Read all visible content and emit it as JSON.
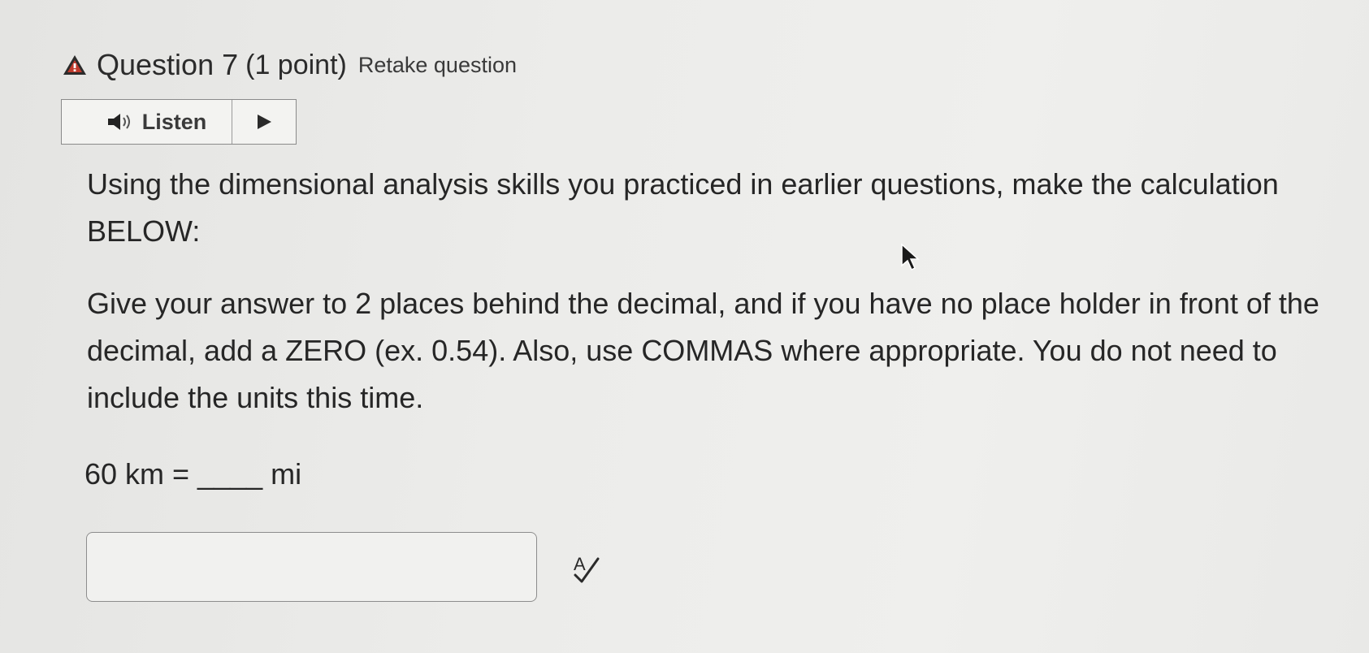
{
  "question": {
    "title": "Question 7",
    "points": "(1 point)",
    "retake_label": "Retake question",
    "status_icon": "warning-triangle-icon",
    "accent_color": "#c0392b"
  },
  "listen": {
    "label": "Listen",
    "speaker_icon": "speaker-icon",
    "play_icon": "play-icon"
  },
  "body": {
    "paragraph1": "Using the dimensional analysis skills you practiced in earlier questions, make the calculation BELOW:",
    "paragraph2": "Give your answer to 2 places behind the decimal, and if you have no place holder in front of the decimal, add a ZERO (ex.  0.54). Also, use COMMAS where appropriate. You do not need to include the units this time."
  },
  "equation": {
    "text": "60 km = ____ mi"
  },
  "answer": {
    "value": "",
    "placeholder": ""
  },
  "spellcheck": {
    "icon": "spellcheck-icon",
    "glyph": "A"
  }
}
